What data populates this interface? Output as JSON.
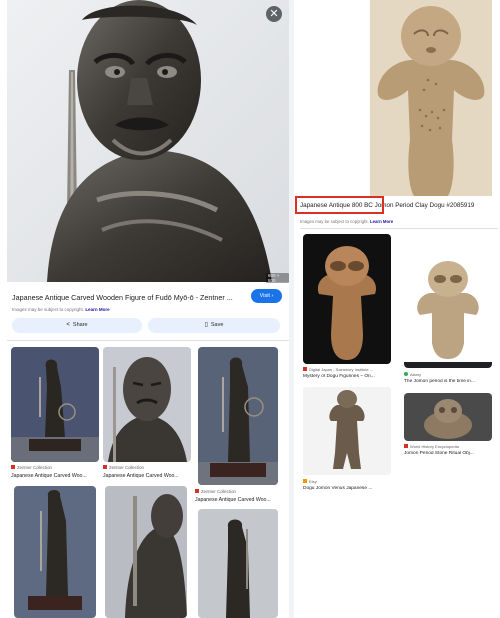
{
  "left_panel": {
    "close_icon": "close-icon",
    "image_dims": "600 × 800",
    "title": "Japanese Antique Carved Wooden Figure of Fudō Myō-ō - Zentner ...",
    "visit_label": "Visit",
    "visit_icon": "chevron-right-icon",
    "copyright_text": "Images may be subject to copyright.",
    "learn_more": "Learn More",
    "share_label": "Share",
    "save_label": "Save",
    "related": [
      {
        "source": "Zentner Collection",
        "caption": "Japanese Antique Carved Woo..."
      },
      {
        "source": "Zentner Collection",
        "caption": "Japanese Antique Carved Woo..."
      },
      {
        "source": "Zentner Collection",
        "caption": "Japanese Antique Carved Woo..."
      }
    ]
  },
  "right_panel": {
    "title_highlighted": "Japanese Antique 800 BC",
    "title_rest": " Jomon Period Clay Dogu #2085919",
    "copyright_text": "Images may be subject to copyright.",
    "learn_more": "Learn More",
    "related": [
      {
        "source": "Digital Japan - Sainsbury Institute ...",
        "caption": "Mystery of Dogu Figurines – On...",
        "fav_color": "#d93025"
      },
      {
        "source": "Alamy",
        "caption": "The Jomon period is the time in...",
        "fav_color": "#34a853"
      },
      {
        "source": "Etsy",
        "caption": "Dogu Jomon Venus Japanese ...",
        "fav_color": "#f29900"
      },
      {
        "source": "World History Encyclopedia",
        "caption": "Jomon Period Stone Ritual Obj...",
        "fav_color": "#d93025"
      }
    ]
  },
  "colors": {
    "accent": "#1a73e8",
    "highlight_box": "#d93025",
    "chip_bg": "#e8f0fe"
  }
}
